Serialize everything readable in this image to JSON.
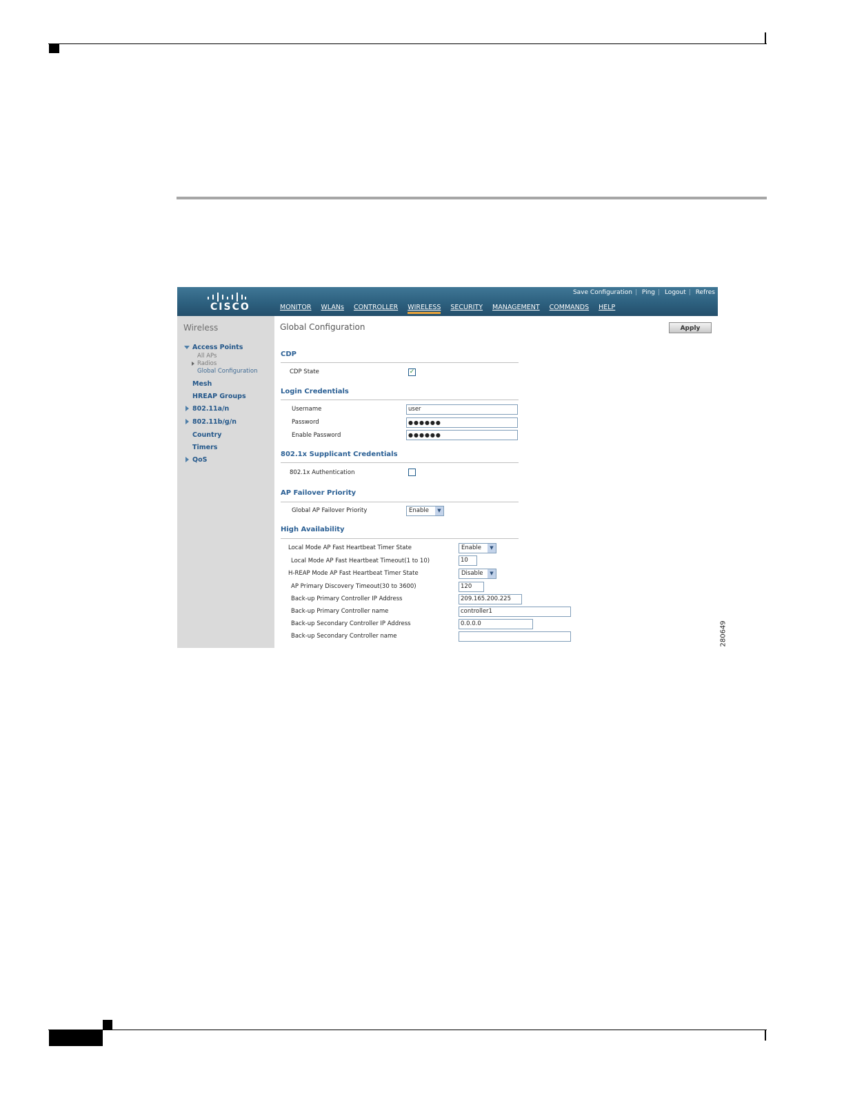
{
  "brand": "CISCO",
  "top_links": [
    "Save Configuration",
    "Ping",
    "Logout",
    "Refres"
  ],
  "nav": [
    "MONITOR",
    "WLANs",
    "CONTROLLER",
    "WIRELESS",
    "SECURITY",
    "MANAGEMENT",
    "COMMANDS",
    "HELP"
  ],
  "nav_active": "WIRELESS",
  "sidebar": {
    "title": "Wireless",
    "access_points": "Access Points",
    "sub_all_aps": "All APs",
    "sub_radios": "Radios",
    "sub_global": "Global Configuration",
    "mesh": "Mesh",
    "hreap": "HREAP Groups",
    "a_n": "802.11a/n",
    "bgn": "802.11b/g/n",
    "country": "Country",
    "timers": "Timers",
    "qos": "QoS"
  },
  "main": {
    "title": "Global Configuration",
    "apply": "Apply",
    "cdp": {
      "heading": "CDP",
      "state_label": "CDP State",
      "state_checked": true
    },
    "login": {
      "heading": "Login Credentials",
      "username_label": "Username",
      "username_value": "user",
      "password_label": "Password",
      "password_value": "●●●●●●",
      "enable_label": "Enable Password",
      "enable_value": "●●●●●●"
    },
    "supplicant": {
      "heading": "802.1x Supplicant Credentials",
      "auth_label": "802.1x Authentication",
      "auth_checked": false
    },
    "failover": {
      "heading": "AP Failover Priority",
      "label": "Global AP Failover Priority",
      "value": "Enable"
    },
    "ha": {
      "heading": "High Availability",
      "local_state_label": "Local Mode AP Fast Heartbeat Timer State",
      "local_state_value": "Enable",
      "local_timeout_label": "Local Mode AP Fast Heartbeat Timeout(1 to 10)",
      "local_timeout_value": "10",
      "hreap_state_label": "H-REAP Mode AP Fast Heartbeat Timer State",
      "hreap_state_value": "Disable",
      "primary_timeout_label": "AP Primary Discovery Timeout(30 to 3600)",
      "primary_timeout_value": "120",
      "bk_primary_ip_label": "Back-up Primary Controller IP Address",
      "bk_primary_ip_value": "209.165.200.225",
      "bk_primary_name_label": "Back-up Primary Controller name",
      "bk_primary_name_value": "controller1",
      "bk_secondary_ip_label": "Back-up Secondary Controller IP Address",
      "bk_secondary_ip_value": "0.0.0.0",
      "bk_secondary_name_label": "Back-up Secondary Controller name",
      "bk_secondary_name_value": ""
    }
  },
  "figure_id": "280649",
  "colors": {
    "header": "#2d607f",
    "accent": "#e9a33a",
    "link": "#2a5f94",
    "sidebar": "#dadada"
  }
}
